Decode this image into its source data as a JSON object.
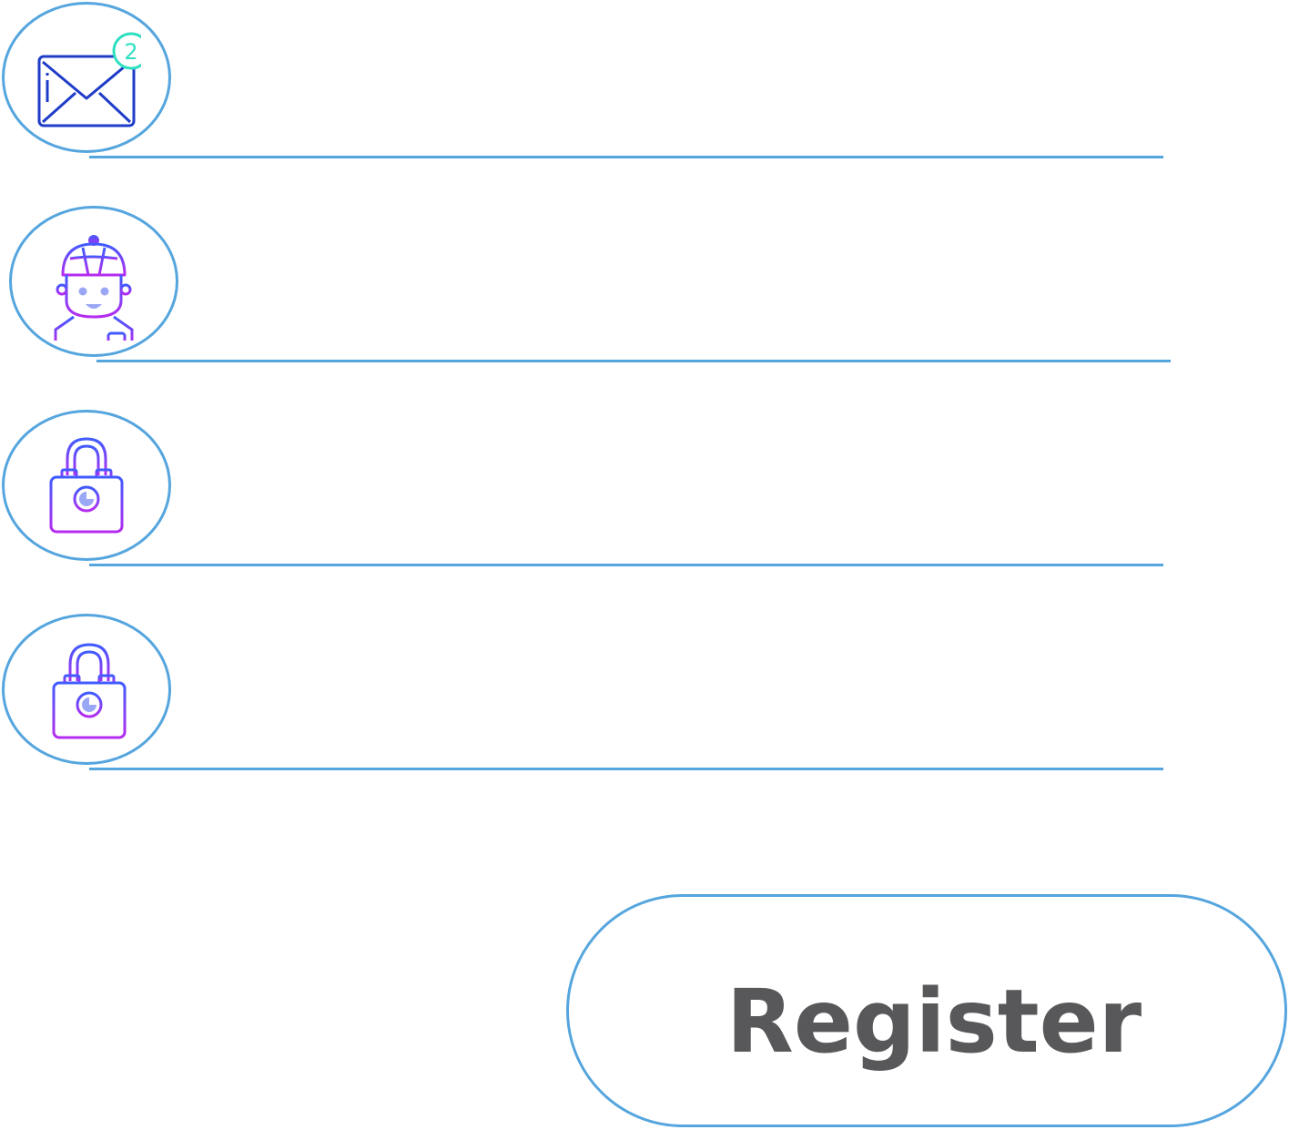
{
  "form": {
    "fields": [
      {
        "id": "email",
        "icon": "envelope-icon",
        "badge": "2",
        "value": "",
        "placeholder": ""
      },
      {
        "id": "username",
        "icon": "user-avatar-icon",
        "value": "",
        "placeholder": ""
      },
      {
        "id": "password",
        "icon": "padlock-icon",
        "value": "",
        "placeholder": ""
      },
      {
        "id": "confirm_password",
        "icon": "padlock-icon",
        "value": "",
        "placeholder": ""
      }
    ],
    "register_label": "Register"
  },
  "colors": {
    "outline": "#55a5de",
    "button_text": "#58585a",
    "icon_blue": "#3f51ff",
    "icon_purple": "#b32cf0",
    "badge_teal": "#2ee0c0"
  }
}
